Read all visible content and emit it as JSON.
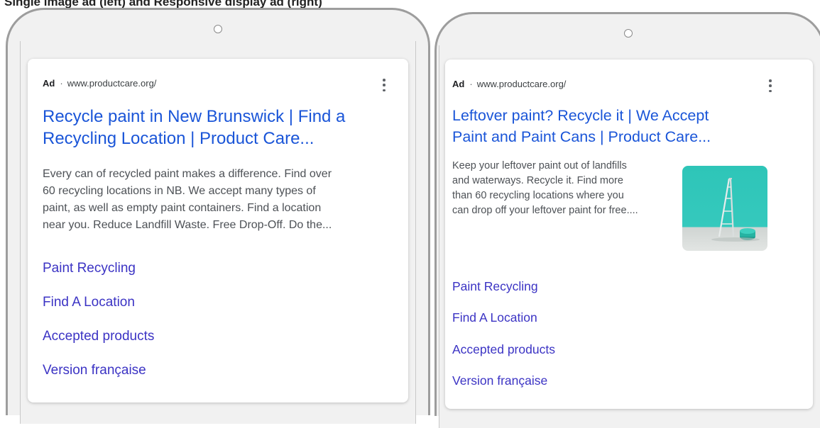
{
  "caption": "Single image ad (left) and Responsive display ad (right)",
  "left_ad": {
    "ad_label": "Ad",
    "separator": "·",
    "display_url": "www.productcare.org/",
    "headline_line1": "Recycle paint in New Brunswick | Find a",
    "headline_line2": "Recycling Location | Product Care...",
    "description_lines": [
      "Every can of recycled paint makes a difference. Find over",
      "60 recycling locations in NB. We accept many types of",
      "paint, as well as empty paint containers. Find a location",
      "near you. Reduce Landfill Waste. Free Drop-Off. Do the..."
    ],
    "sitelinks": [
      "Paint Recycling",
      "Find A Location",
      "Accepted products",
      "Version française"
    ]
  },
  "right_ad": {
    "ad_label": "Ad",
    "separator": "·",
    "display_url": "www.productcare.org/",
    "headline_line1": "Leftover paint? Recycle it | We Accept",
    "headline_line2": "Paint and Paint Cans | Product Care...",
    "description_lines": [
      "Keep your leftover paint out of landfills",
      "and waterways. Recycle it. Find more",
      "than 60 recycling locations where you",
      "can drop off your leftover paint for free...."
    ],
    "sitelinks": [
      "Paint Recycling",
      "Find A Location",
      "Accepted products",
      "Version française"
    ]
  },
  "colors": {
    "headline": "#1a55d8",
    "sitelink": "#3b33c4",
    "body_text": "#4d5156",
    "thumbnail_wall": "#2ec5b8"
  }
}
